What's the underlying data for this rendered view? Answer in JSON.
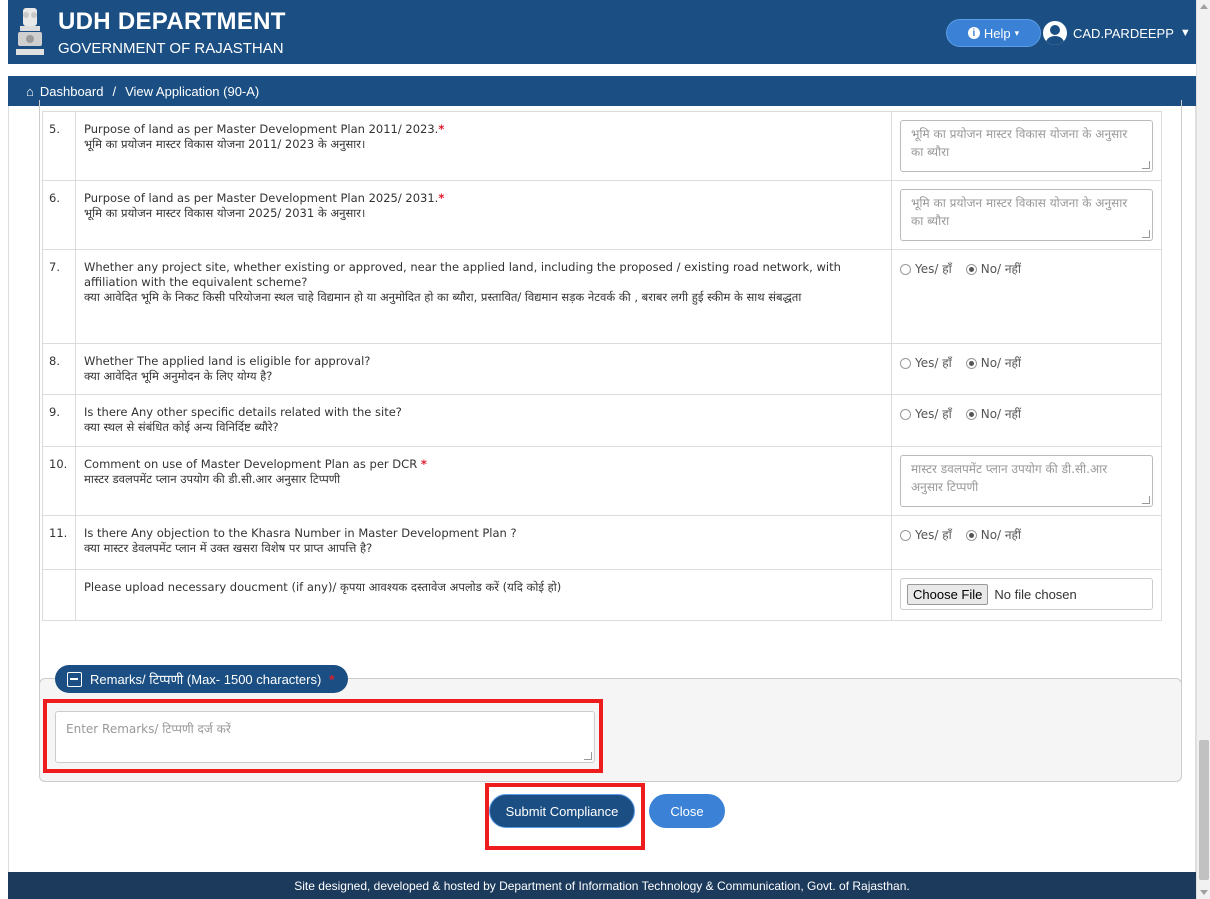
{
  "header": {
    "title": "UDH DEPARTMENT",
    "subtitle": "GOVERNMENT OF RAJASTHAN",
    "help_label": "Help",
    "user_label": "CAD.PARDEEPP",
    "brand_color": "#1b4f83"
  },
  "breadcrumb": {
    "home_icon": "home-icon",
    "items": [
      "Dashboard",
      "View Application (90-A)"
    ],
    "separator": "/"
  },
  "questions": [
    {
      "num": "5.",
      "en": "Purpose of land as per Master Development Plan 2011/ 2023.",
      "required": "*",
      "hi": "भूमि का प्रयोजन मास्टर विकास योजना 2011/ 2023 के अनुसार।",
      "placeholder": "भूमि का प्रयोजन मास्टर विकास योजना के अनुसार का ब्यौरा"
    },
    {
      "num": "6.",
      "en": "Purpose of land as per Master Development Plan 2025/ 2031.",
      "required": "*",
      "hi": "भूमि का प्रयोजन मास्टर विकास योजना 2025/ 2031 के अनुसार।",
      "placeholder": "भूमि का प्रयोजन मास्टर विकास योजना के अनुसार का ब्यौरा"
    },
    {
      "num": "7.",
      "en": "Whether any project site, whether existing or approved, near the applied land, including the proposed / existing road network, with affiliation with the equivalent scheme?",
      "hi": "क्या आवेदित भूमि के निकट किसी परियोजना स्थल चाहे विद्यमान हो या अनुमोदित हो का ब्यौरा, प्रस्तावित/ विद्यमान सड़क नेटवर्क की , बराबर लगी हुई स्कीम के साथ संबद्धता",
      "yes": "Yes/ हाँ",
      "no": "No/ नहीं",
      "selected": "no"
    },
    {
      "num": "8.",
      "en": "Whether The applied land is eligible for approval?",
      "hi": "क्या आवेदित भूमि अनुमोदन के लिए योग्य है?",
      "yes": "Yes/ हाँ",
      "no": "No/ नहीं",
      "selected": "no"
    },
    {
      "num": "9.",
      "en": "Is there Any other specific details related with the site?",
      "hi": "क्या स्थल से संबंधित कोई अन्य विनिर्दिष्ट ब्यौरे?",
      "yes": "Yes/ हाँ",
      "no": "No/ नहीं",
      "selected": "no"
    },
    {
      "num": "10.",
      "en": "Comment on use of Master Development Plan as per DCR",
      "required": "*",
      "hi": "मास्टर डवलपमेंट प्लान उपयोग की डी.सी.आर अनुसार टिप्पणी",
      "placeholder": "मास्टर डवलपमेंट प्लान उपयोग की डी.सी.आर अनुसार टिप्पणी"
    },
    {
      "num": "11.",
      "en": "Is there Any objection to the Khasra Number in Master Development Plan ?",
      "hi": "क्या मास्टर डेवलपमेंट प्लान में उक्त खसरा विशेष पर प्राप्त आपत्ति है?",
      "yes": "Yes/ हाँ",
      "no": "No/ नहीं",
      "selected": "no"
    }
  ],
  "upload": {
    "label": "Please upload necessary doucment (if any)/ कृपया आवश्यक दस्तावेज अपलोड करें (यदि कोई हो)",
    "button": "Choose File",
    "status": "No file chosen"
  },
  "remarks": {
    "title": "Remarks/ टिप्पणी (Max- 1500 characters)",
    "required": "*",
    "placeholder": "Enter Remarks/ टिप्पणी दर्ज करें"
  },
  "actions": {
    "submit": "Submit Compliance",
    "close": "Close"
  },
  "footer": {
    "text": "Site designed, developed & hosted by Department of Information Technology & Communication, Govt. of Rajasthan."
  }
}
